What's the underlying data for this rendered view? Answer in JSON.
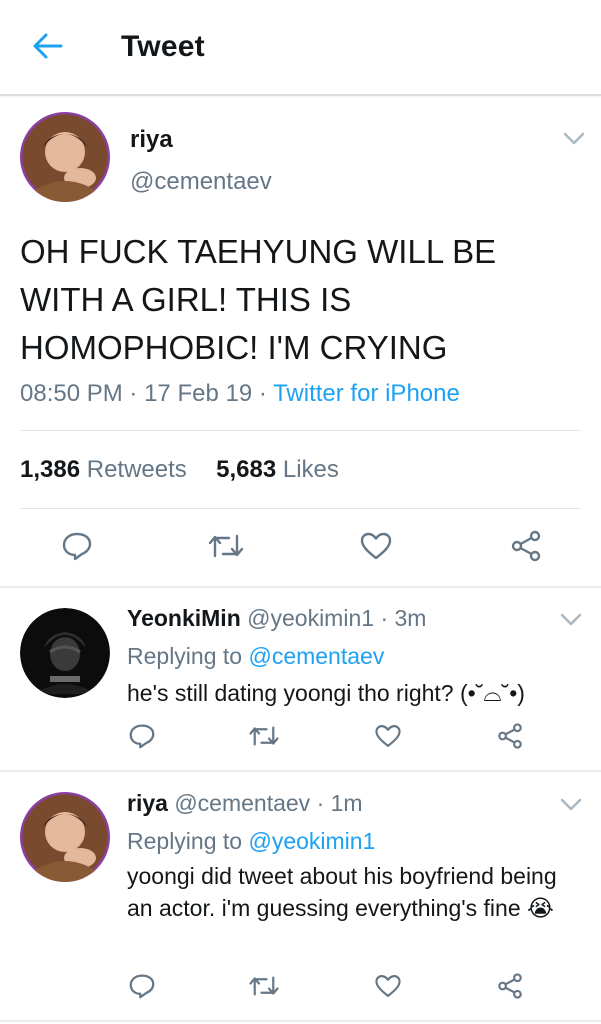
{
  "header": {
    "title": "Tweet",
    "back_icon": "arrow-left-icon"
  },
  "main_tweet": {
    "name": "riya",
    "handle": "@cementaev",
    "text": "OH FUCK TAEHYUNG WILL BE WITH A GIRL! THIS IS HOMOPHOBIC! I'M CRYING",
    "time": "08:50 PM",
    "date": "17 Feb 19",
    "source": "Twitter for iPhone",
    "retweets_count": "1,386",
    "retweets_label": "Retweets",
    "likes_count": "5,683",
    "likes_label": "Likes"
  },
  "replies": [
    {
      "name": "YeonkiMin",
      "handle": "@yeokimin1",
      "age": "3m",
      "replying_label": "Replying to",
      "replying_to": "@cementaev",
      "text": "he's still dating yoongi tho right? (•˘⌓˘•)"
    },
    {
      "name": "riya",
      "handle": "@cementaev",
      "age": "1m",
      "replying_label": "Replying to",
      "replying_to": "@yeokimin1",
      "text": "yoongi did tweet about his boyfriend being an actor. i'm guessing everything's fine 😭"
    }
  ],
  "colors": {
    "accent": "#1da1f2",
    "muted": "#657786",
    "text": "#14171a"
  }
}
